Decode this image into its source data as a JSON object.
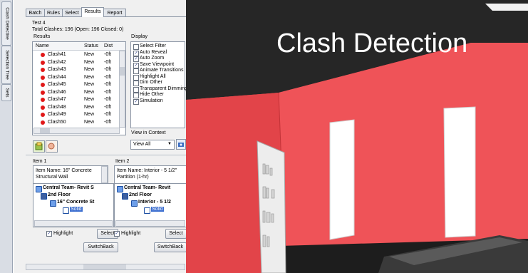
{
  "side_tabs": [
    "Clash Detective",
    "Selection Tree",
    "Sets"
  ],
  "tabs": [
    "Batch",
    "Rules",
    "Select",
    "Results",
    "Report"
  ],
  "active_tab": "Results",
  "test_name": "Test 4",
  "summary": "Total Clashes: 196 (Open: 196  Closed: 0)",
  "results": {
    "group_label": "Results",
    "columns": [
      "Name",
      "Status",
      "Dist"
    ],
    "rows": [
      {
        "name": "Clash41",
        "status": "New",
        "dist": "-0ft"
      },
      {
        "name": "Clash42",
        "status": "New",
        "dist": "-0ft"
      },
      {
        "name": "Clash43",
        "status": "New",
        "dist": "-0ft"
      },
      {
        "name": "Clash44",
        "status": "New",
        "dist": "-0ft"
      },
      {
        "name": "Clash45",
        "status": "New",
        "dist": "-0ft"
      },
      {
        "name": "Clash46",
        "status": "New",
        "dist": "-0ft"
      },
      {
        "name": "Clash47",
        "status": "New",
        "dist": "-0ft"
      },
      {
        "name": "Clash48",
        "status": "New",
        "dist": "-0ft"
      },
      {
        "name": "Clash49",
        "status": "New",
        "dist": "-0ft"
      },
      {
        "name": "Clash50",
        "status": "New",
        "dist": "-0ft"
      }
    ],
    "status_color": "#e11919"
  },
  "display": {
    "label": "Display",
    "options": [
      {
        "label": "Select Filter",
        "checked": false
      },
      {
        "label": "Auto Reveal",
        "checked": true
      },
      {
        "label": "Auto Zoom",
        "checked": true
      },
      {
        "label": "Save Viewpoint",
        "checked": true
      },
      {
        "label": "Animate Transitions",
        "checked": false
      },
      {
        "label": "Highlight All",
        "checked": false
      },
      {
        "label": "Dim Other",
        "checked": false
      },
      {
        "label": "Transparent Dimming",
        "checked": false
      },
      {
        "label": "Hide Other",
        "checked": false
      },
      {
        "label": "Simulation",
        "checked": true
      }
    ],
    "view_in_context_label": "View in Context",
    "view_select_value": "View All"
  },
  "item1": {
    "label": "Item 1",
    "item_name": "Item Name: 16\" Concrete Structural Wall",
    "tree": [
      "Central Team- Revit S",
      "2nd Floor",
      "16\" Concrete St",
      "Solid"
    ],
    "highlight_label": "Highlight",
    "select_label": "Select",
    "switchback_label": "SwitchBack"
  },
  "item2": {
    "label": "Item 2",
    "item_name": "Item Name: Interior - 5 1/2\" Partition (1-hr)",
    "tree": [
      "Central Team- Revit",
      "2nd Floor",
      "Interior - 5 1/2",
      "Solid"
    ],
    "highlight_label": "Highlight",
    "select_label": "Select",
    "switchback_label": "SwitchBack"
  },
  "overlay_title": "Clash Detection",
  "colors": {
    "wall_red": "#ea4e53",
    "ceiling": "#262626",
    "floor": "#1d1d1d",
    "door": "#ffffff"
  }
}
